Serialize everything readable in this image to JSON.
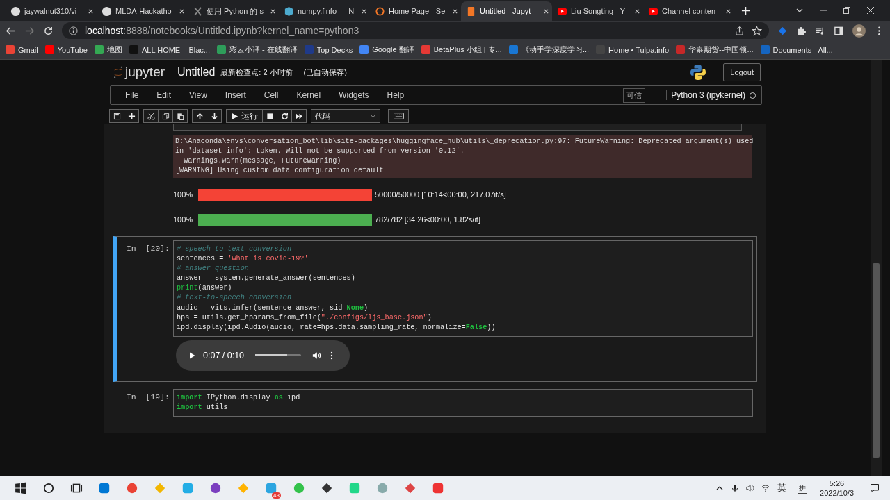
{
  "browser": {
    "tabs": [
      {
        "title": "jaywalnut310/vi",
        "selected": false
      },
      {
        "title": "MLDA-Hackatho",
        "selected": false
      },
      {
        "title": "使用 Python 的 s",
        "selected": false
      },
      {
        "title": "numpy.finfo — N",
        "selected": false
      },
      {
        "title": "Home Page - Se",
        "selected": false
      },
      {
        "title": "Untitled - Jupyt",
        "selected": true
      },
      {
        "title": "Liu Songting - Y",
        "selected": false
      },
      {
        "title": "Channel conten",
        "selected": false
      }
    ],
    "url_host": "localhost",
    "url_path": ":8888/notebooks/Untitled.ipynb?kernel_name=python3",
    "bookmarks": [
      {
        "label": "Gmail",
        "color": "#ea4335"
      },
      {
        "label": "YouTube",
        "color": "#ff0000"
      },
      {
        "label": "地图",
        "color": "#34a853"
      },
      {
        "label": "ALL HOME – Blac...",
        "color": "#111111"
      },
      {
        "label": "彩云小译 - 在线翻译",
        "color": "#2e9d5a"
      },
      {
        "label": "Top Decks",
        "color": "#1f3a8a"
      },
      {
        "label": "Google 翻译",
        "color": "#4285f4"
      },
      {
        "label": "BetaPlus 小组 | 专...",
        "color": "#e53935"
      },
      {
        "label": "《动手学深度学习...",
        "color": "#1976d2"
      },
      {
        "label": "Home • Tulpa.info",
        "color": "#444444"
      },
      {
        "label": "华泰期货--中国领...",
        "color": "#c62828"
      },
      {
        "label": "Documents - All...",
        "color": "#1565c0"
      }
    ]
  },
  "jupyter": {
    "logo": "jupyter",
    "title": "Untitled",
    "checkpoint": "最新检查点: 2 小时前",
    "autosave": "(已自动保存)",
    "logout": "Logout",
    "menu": [
      "File",
      "Edit",
      "View",
      "Insert",
      "Cell",
      "Kernel",
      "Widgets",
      "Help"
    ],
    "trusted": "可信",
    "kernel": "Python 3 (ipykernel)",
    "kernel_busy": false,
    "run_label": "运行",
    "cell_type": "代码"
  },
  "stderr": [
    "D:\\Anaconda\\envs\\conversation_bot\\lib\\site-packages\\huggingface_hub\\utils\\_deprecation.py:97: FutureWarning: Deprecated argument(s) used",
    "in 'dataset_info': token. Will not be supported from version '0.12'.",
    "  warnings.warn(message, FutureWarning)",
    "[WARNING] Using custom data configuration default"
  ],
  "progress": [
    {
      "percent": "100%",
      "level": 1,
      "color": "#f44336",
      "info": "50000/50000 [10:14<00:00, 217.07it/s]"
    },
    {
      "percent": "100%",
      "level": 1,
      "color": "#4caf50",
      "info": "782/782 [34:26<00:00, 1.82s/it]"
    }
  ],
  "cells": [
    {
      "prompt": "In  [20]:",
      "selected": true,
      "lines": [
        [
          {
            "kind": "comment",
            "text": "# speech-to-text conversion"
          }
        ],
        [
          {
            "kind": "plain",
            "text": "sentences = "
          },
          {
            "kind": "string",
            "text": "'what is covid-19?'"
          }
        ],
        [
          {
            "kind": "comment",
            "text": "# answer question"
          }
        ],
        [
          {
            "kind": "plain",
            "text": "answer = system.generate_answer(sentences)"
          }
        ],
        [
          {
            "kind": "builtin",
            "text": "print"
          },
          {
            "kind": "plain",
            "text": "(answer)"
          }
        ],
        [
          {
            "kind": "comment",
            "text": "# text-to-speech conversion"
          }
        ],
        [
          {
            "kind": "plain",
            "text": "audio = vits.infer(sentence=answer, sid="
          },
          {
            "kind": "keyword",
            "text": "None"
          },
          {
            "kind": "plain",
            "text": ")"
          }
        ],
        [
          {
            "kind": "plain",
            "text": "hps = utils.get_hparams_from_file("
          },
          {
            "kind": "string",
            "text": "\"./configs/ljs_base.json\""
          },
          {
            "kind": "plain",
            "text": ")"
          }
        ],
        [
          {
            "kind": "plain",
            "text": "ipd.display(ipd.Audio(audio, rate=hps.data.sampling_rate, normalize="
          },
          {
            "kind": "keyword",
            "text": "False"
          },
          {
            "kind": "plain",
            "text": "))"
          }
        ]
      ],
      "audio": {
        "time": "0:07 / 0:10",
        "level": 0.7
      }
    },
    {
      "prompt": "In  [19]:",
      "selected": false,
      "lines": [
        [
          {
            "kind": "keyword",
            "text": "import"
          },
          {
            "kind": "plain",
            "text": " IPython.display "
          },
          {
            "kind": "keyword",
            "text": "as"
          },
          {
            "kind": "plain",
            "text": " ipd"
          }
        ],
        [
          {
            "kind": "keyword",
            "text": "import"
          },
          {
            "kind": "plain",
            "text": " utils"
          }
        ]
      ]
    }
  ],
  "taskbar": {
    "badge": "43",
    "ime": "英",
    "ime_mode": "拼",
    "time": "5:26",
    "date": "2022/10/3"
  }
}
